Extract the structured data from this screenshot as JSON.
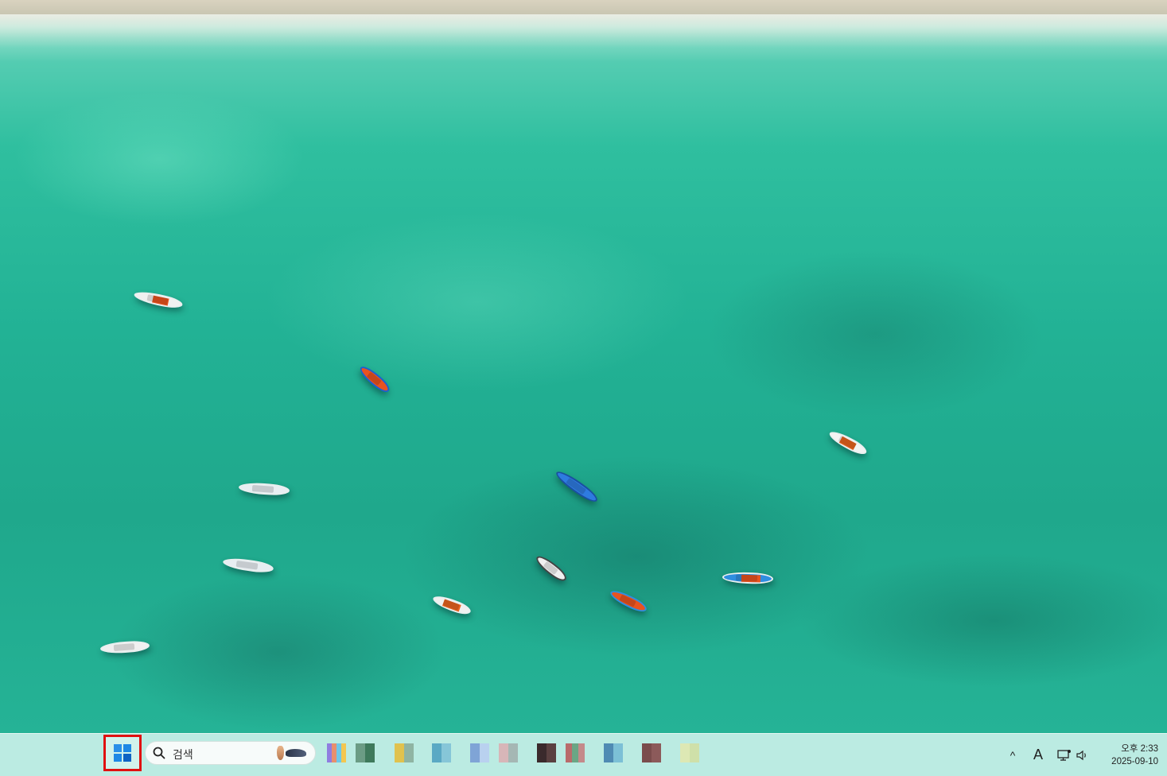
{
  "wallpaper": {
    "theme": "aerial view of turquoise sea with small boats",
    "colors": {
      "water_light": "#6fd6bf",
      "water_mid": "#22b295",
      "water_dark": "#1fa88c",
      "sand": "#d9d2bf"
    }
  },
  "taskbar": {
    "start_highlight_color": "#e01010",
    "search": {
      "placeholder": "검색",
      "icon": "search-icon"
    },
    "pinned_apps": [
      {
        "name": "app-1",
        "colors": [
          "#8f7de0",
          "#e78f6d",
          "#6dc7ea",
          "#f3c750"
        ]
      },
      {
        "name": "app-2",
        "colors": [
          "#6b9c85",
          "#3e7a5c"
        ]
      },
      {
        "name": "app-3",
        "colors": [
          "#e0c24e",
          "#8fb4a3"
        ]
      },
      {
        "name": "app-4",
        "colors": [
          "#5aa9c4",
          "#86c6d8"
        ]
      },
      {
        "name": "app-5",
        "colors": [
          "#7fa4d6",
          "#b9d1ef"
        ]
      },
      {
        "name": "app-6",
        "colors": [
          "#d7b6b8",
          "#a5b7b4"
        ]
      },
      {
        "name": "app-7",
        "colors": [
          "#3a2a2c",
          "#5a4040"
        ]
      },
      {
        "name": "app-8",
        "colors": [
          "#b96b6b",
          "#6aa685",
          "#c48a8a"
        ]
      },
      {
        "name": "app-9",
        "colors": [
          "#4f8bb3",
          "#7cc0d6"
        ]
      },
      {
        "name": "app-10",
        "colors": [
          "#7a4c4c",
          "#8c5a5a"
        ]
      },
      {
        "name": "app-11",
        "colors": [
          "#dde8b4",
          "#cfe0a9"
        ]
      }
    ],
    "tray": {
      "chevron": "^",
      "ime_indicator": "A",
      "network_icon": "network-icon",
      "volume_icon": "volume-icon",
      "time": "오후 2:33",
      "date": "2025-09-10"
    }
  }
}
